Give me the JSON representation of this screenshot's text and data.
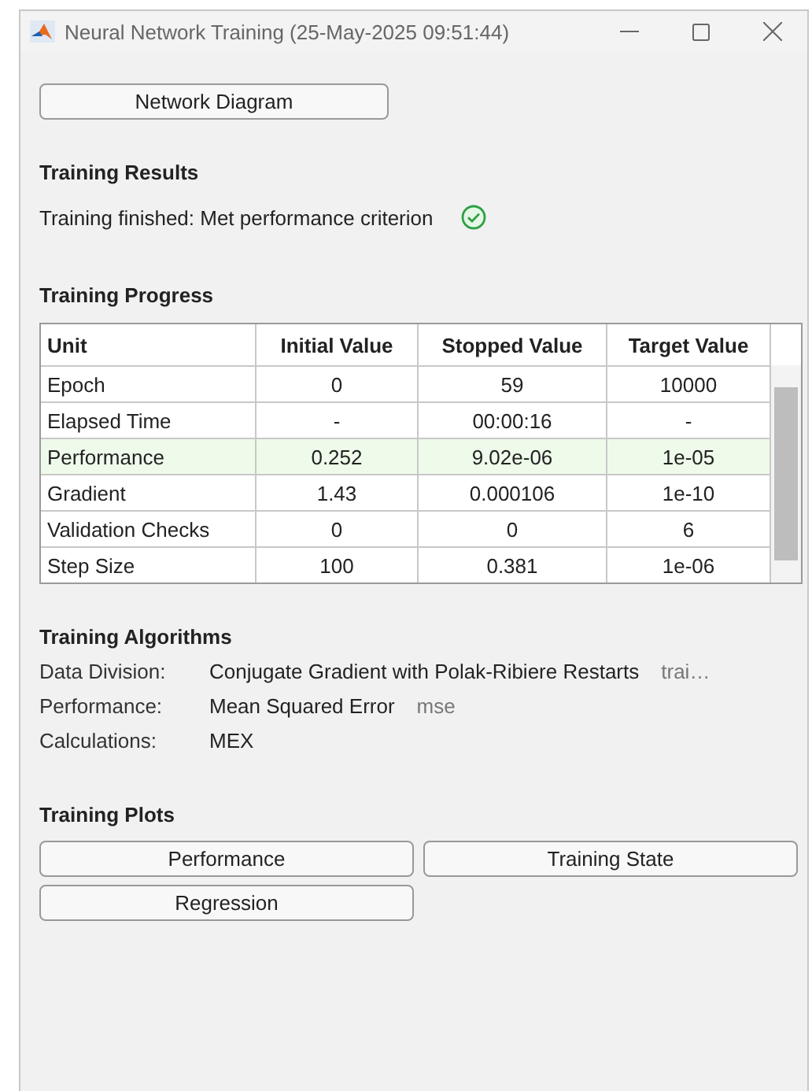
{
  "window": {
    "title": "Neural Network Training (25-May-2025 09:51:44)"
  },
  "network_button": "Network Diagram",
  "training_results": {
    "heading": "Training Results",
    "status": "Training finished: Met performance criterion",
    "success": true
  },
  "training_progress": {
    "heading": "Training Progress",
    "columns": [
      "Unit",
      "Initial Value",
      "Stopped Value",
      "Target Value"
    ],
    "rows": [
      {
        "cells": [
          "Epoch",
          "0",
          "59",
          "10000"
        ],
        "highlighted": false
      },
      {
        "cells": [
          "Elapsed Time",
          "-",
          "00:00:16",
          "-"
        ],
        "highlighted": false
      },
      {
        "cells": [
          "Performance",
          "0.252",
          "9.02e-06",
          "1e-05"
        ],
        "highlighted": true
      },
      {
        "cells": [
          "Gradient",
          "1.43",
          "0.000106",
          "1e-10"
        ],
        "highlighted": false
      },
      {
        "cells": [
          "Validation Checks",
          "0",
          "0",
          "6"
        ],
        "highlighted": false
      },
      {
        "cells": [
          "Step Size",
          "100",
          "0.381",
          "1e-06"
        ],
        "highlighted": false
      }
    ]
  },
  "training_algorithms": {
    "heading": "Training Algorithms",
    "items": [
      {
        "label": "Data Division:",
        "value": "Conjugate Gradient with Polak-Ribiere Restarts",
        "code": "trai…"
      },
      {
        "label": "Performance:",
        "value": "Mean Squared Error",
        "code": "mse"
      },
      {
        "label": "Calculations:",
        "value": "MEX"
      }
    ]
  },
  "training_plots": {
    "heading": "Training Plots",
    "buttons": [
      "Performance",
      "Training State",
      "Regression"
    ]
  }
}
